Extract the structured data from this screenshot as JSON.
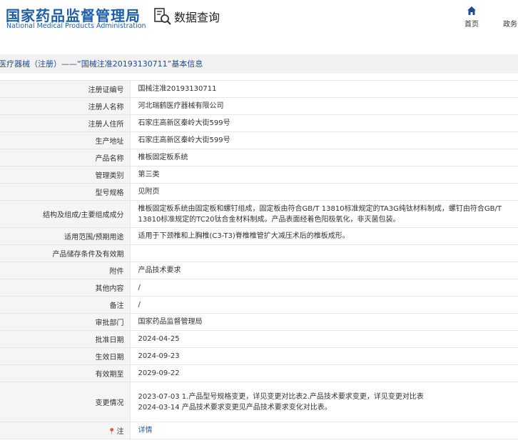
{
  "header": {
    "logo_cn": "国家药品监督管理局",
    "logo_en": "National Medical Products Administration",
    "query_label": "数据查询",
    "nav": {
      "home": "首页",
      "gov": "政务"
    }
  },
  "breadcrumb": "医疗器械（注册）——“国械注准20193130711”基本信息",
  "rows": [
    {
      "label": "注册证编号",
      "value": "国械注准20193130711"
    },
    {
      "label": "注册人名称",
      "value": "河北瑞鹤医疗器械有限公司"
    },
    {
      "label": "注册人住所",
      "value": "石家庄高新区秦岭大街599号"
    },
    {
      "label": "生产地址",
      "value": "石家庄高新区秦岭大街599号"
    },
    {
      "label": "产品名称",
      "value": "椎板固定板系统"
    },
    {
      "label": "管理类别",
      "value": "第三类"
    },
    {
      "label": "型号规格",
      "value": "见附页"
    },
    {
      "label": "结构及组成/主要组成成分",
      "value": "椎板固定板系统由固定板和螺钉组成，固定板由符合GB/T 13810标准规定的TA3G纯钛材料制成，螺钉由符合GB/T 13810标准规定的TC20钛合金材料制成。产品表面经着色阳极氧化，非灭菌包装。"
    },
    {
      "label": "适用范围/预期用途",
      "value": "适用于下颈椎和上胸椎(C3-T3)脊椎椎管扩大减压术后的椎板成形。"
    },
    {
      "label": "产品储存条件及有效期",
      "value": ""
    },
    {
      "label": "附件",
      "value": "产品技术要求"
    },
    {
      "label": "其他内容",
      "value": "/"
    },
    {
      "label": "备注",
      "value": "/"
    },
    {
      "label": "审批部门",
      "value": "国家药品监督管理局"
    },
    {
      "label": "批准日期",
      "value": "2024-04-25"
    },
    {
      "label": "生效日期",
      "value": "2024-09-23"
    },
    {
      "label": "有效期至",
      "value": "2029-09-22"
    },
    {
      "label": "变更情况",
      "value": "2023-07-03 1.产品型号规格变更，详见变更对比表2.产品技术要求变更，详见变更对比表\n2024-03-14 产品技术要求变更见产品技术要求变化对比表。"
    },
    {
      "label": "注",
      "value": "详情"
    }
  ]
}
